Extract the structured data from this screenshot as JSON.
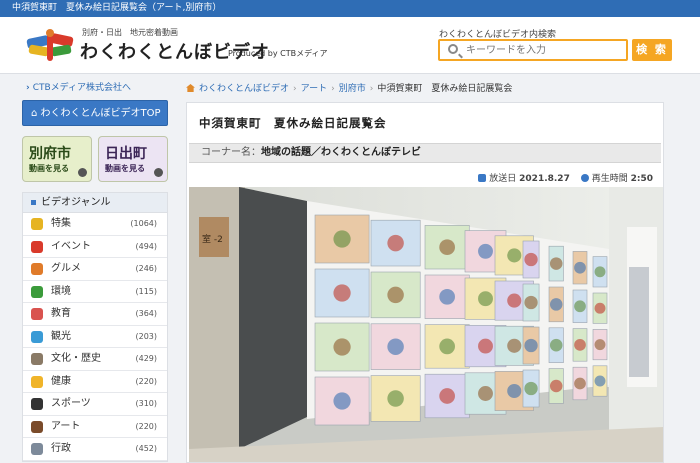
{
  "topbar": {
    "text": "中須賀東町　夏休み絵日記展覧会（アート,別府市）"
  },
  "header": {
    "tagline": "別府・日出　地元密着動画",
    "brand": "わくわくとんぼビデオ",
    "produced_by": "Produced by CTBメディア",
    "search_label": "わくわくとんぼビデオ内検索",
    "search_placeholder": "キーワードを入力",
    "search_button": "検 索"
  },
  "sidebar": {
    "company_link": "CTBメディア株式会社へ",
    "top_button": "わくわくとんぼビデオTOP",
    "banners": [
      {
        "title": "別府市",
        "sub": "動画を見る"
      },
      {
        "title": "日出町",
        "sub": "動画を見る"
      }
    ],
    "genre_heading": "ビデオジャンル",
    "genres": [
      {
        "label": "特集",
        "count": "(1064)",
        "color": "#e6b422"
      },
      {
        "label": "イベント",
        "count": "(494)",
        "color": "#d93a2b"
      },
      {
        "label": "グルメ",
        "count": "(246)",
        "color": "#e07b2a"
      },
      {
        "label": "環境",
        "count": "(115)",
        "color": "#3b9b3b"
      },
      {
        "label": "教育",
        "count": "(364)",
        "color": "#d9534f"
      },
      {
        "label": "観光",
        "count": "(203)",
        "color": "#3a9bd6"
      },
      {
        "label": "文化・歴史",
        "count": "(429)",
        "color": "#8a7a66"
      },
      {
        "label": "健康",
        "count": "(220)",
        "color": "#f0b429"
      },
      {
        "label": "スポーツ",
        "count": "(310)",
        "color": "#333333"
      },
      {
        "label": "アート",
        "count": "(220)",
        "color": "#7a4b2a"
      },
      {
        "label": "行政",
        "count": "(452)",
        "color": "#7d8a9a"
      }
    ]
  },
  "breadcrumb": [
    "わくわくとんぼビデオ",
    "アート",
    "別府市",
    "中須賀東町　夏休み絵日記展覧会"
  ],
  "video": {
    "title": "中須賀東町　夏休み絵日記展覧会",
    "corner_label": "コーナー名：",
    "corner_value": "地域の話題／わくわくとんぼテレビ",
    "air_label": "放送日",
    "air_date": "2021.8.27",
    "duration_label": "再生時間",
    "duration": "2:50",
    "room_sign": "室 -2"
  }
}
